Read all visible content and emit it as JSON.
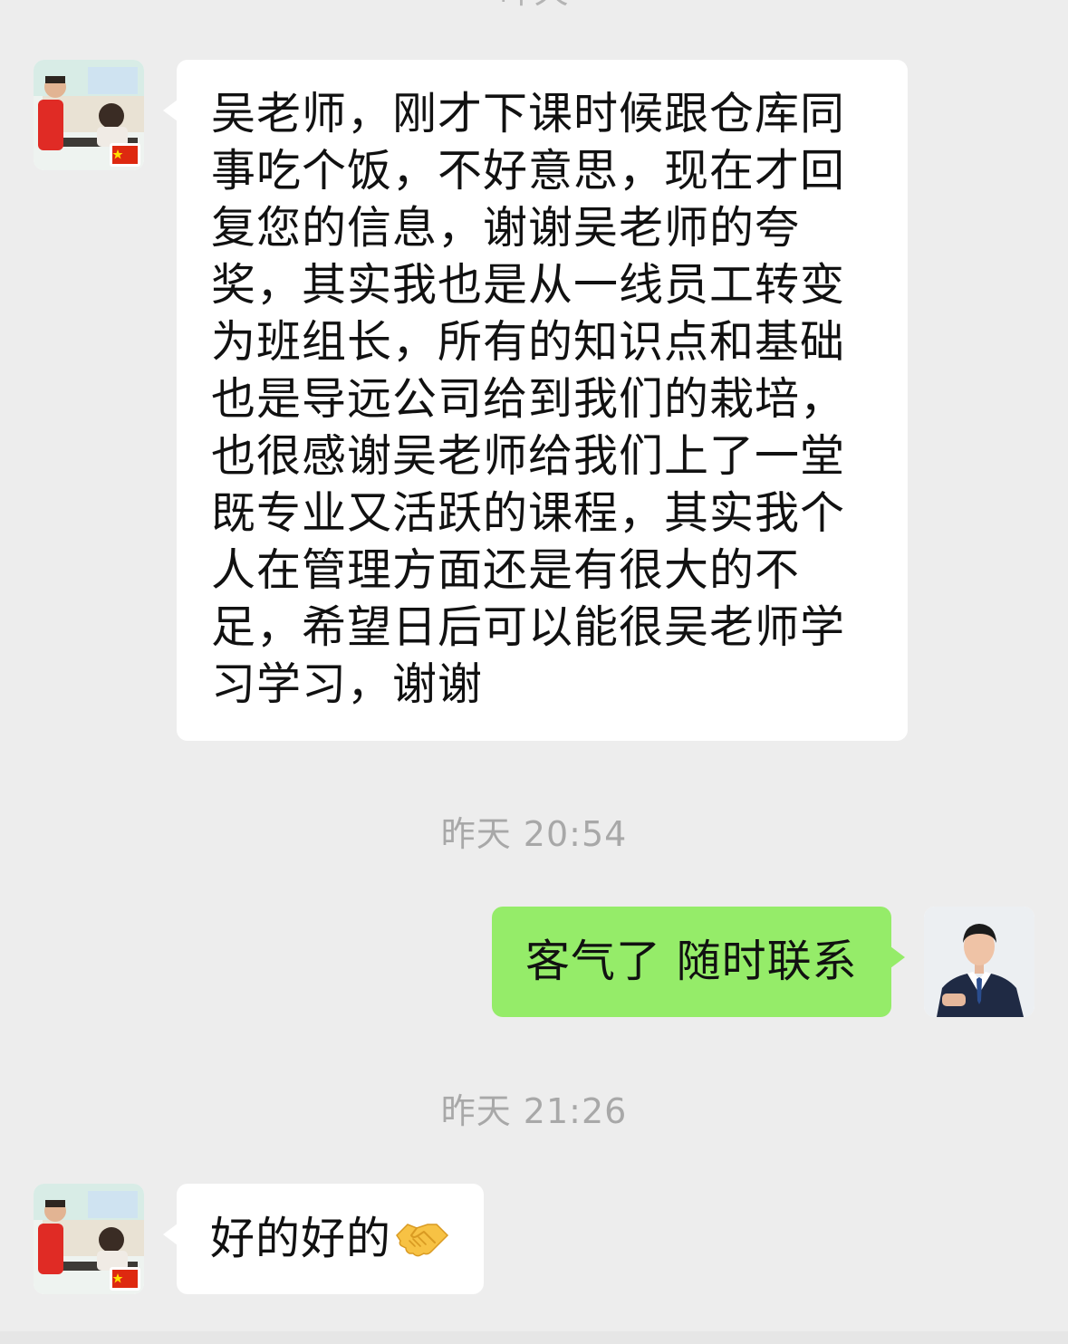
{
  "chat": {
    "partial_top_timestamp": "昨天",
    "messages": [
      {
        "id": "msg1",
        "direction": "incoming",
        "text": "吴老师，刚才下课时候跟仓库同事吃个饭，不好意思，现在才回复您的信息，谢谢吴老师的夸奖，其实我也是从一线员工转变为班组长，所有的知识点和基础也是导远公司给到我们的栽培，也很感谢吴老师给我们上了一堂既专业又活跃的课程，其实我个人在管理方面还是有很大的不足，希望日后可以能很吴老师学习学习，谢谢"
      },
      {
        "id": "msg2",
        "direction": "outgoing",
        "timestamp": "昨天 20:54",
        "text": "客气了 随时联系"
      },
      {
        "id": "msg3",
        "direction": "incoming",
        "timestamp": "昨天 21:26",
        "text": "好的好的",
        "emoji": "handshake-icon"
      }
    ]
  },
  "colors": {
    "background": "#ededed",
    "incoming_bubble": "#ffffff",
    "outgoing_bubble": "#95ec69",
    "timestamp_text": "#a8a8a8"
  }
}
